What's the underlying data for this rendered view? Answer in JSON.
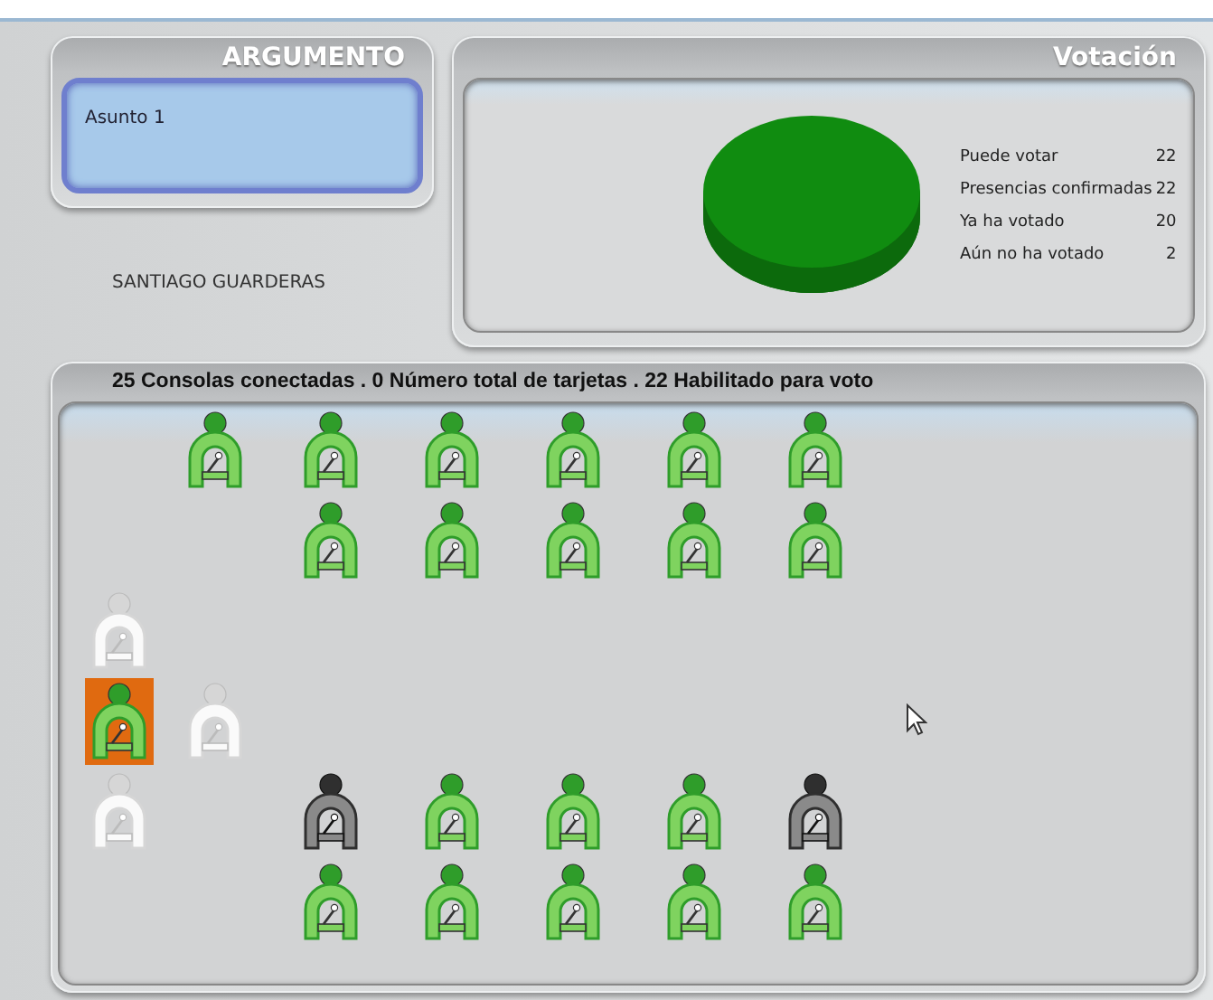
{
  "argument": {
    "title": "ARGUMENTO",
    "subject": "Asunto 1",
    "speaker": "SANTIAGO GUARDERAS"
  },
  "voting": {
    "title": "Votación",
    "stats": [
      {
        "label": "Puede votar",
        "value": "22"
      },
      {
        "label": "Presencias confirmadas",
        "value": "22"
      },
      {
        "label": "Ya ha votado",
        "value": "20"
      },
      {
        "label": "Aún no ha votado",
        "value": "2"
      }
    ]
  },
  "consoles": {
    "summary": "25 Consolas conectadas . 0 Número total de tarjetas . 22 Habilitado para voto",
    "rows": [
      [
        {
          "kind": "gap"
        },
        {
          "kind": "voted",
          "selected": false
        },
        {
          "kind": "voted",
          "selected": false
        },
        {
          "kind": "voted",
          "selected": false
        },
        {
          "kind": "voted",
          "selected": false
        },
        {
          "kind": "voted",
          "selected": false
        },
        {
          "kind": "voted",
          "selected": false
        }
      ],
      [
        {
          "kind": "gap"
        },
        {
          "kind": "gap"
        },
        {
          "kind": "voted",
          "selected": false
        },
        {
          "kind": "voted",
          "selected": false
        },
        {
          "kind": "voted",
          "selected": false
        },
        {
          "kind": "voted",
          "selected": false
        },
        {
          "kind": "voted",
          "selected": false
        }
      ],
      [
        {
          "kind": "absent",
          "selected": false
        }
      ],
      [
        {
          "kind": "voted",
          "selected": true
        },
        {
          "kind": "absent",
          "selected": false
        }
      ],
      [
        {
          "kind": "absent",
          "selected": false
        },
        {
          "kind": "gap"
        },
        {
          "kind": "pending",
          "selected": false
        },
        {
          "kind": "voted",
          "selected": false
        },
        {
          "kind": "voted",
          "selected": false
        },
        {
          "kind": "voted",
          "selected": false
        },
        {
          "kind": "pending",
          "selected": false
        }
      ],
      [
        {
          "kind": "gap"
        },
        {
          "kind": "gap"
        },
        {
          "kind": "voted",
          "selected": false
        },
        {
          "kind": "voted",
          "selected": false
        },
        {
          "kind": "voted",
          "selected": false
        },
        {
          "kind": "voted",
          "selected": false
        },
        {
          "kind": "voted",
          "selected": false
        }
      ]
    ]
  }
}
